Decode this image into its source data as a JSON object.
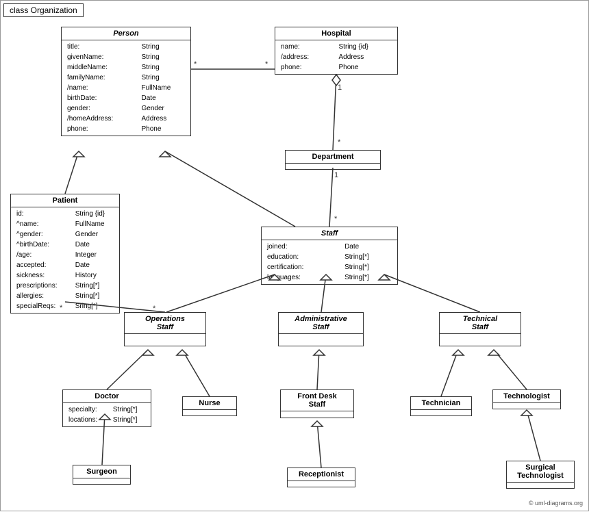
{
  "title": "class Organization",
  "classes": {
    "person": {
      "name": "Person",
      "italic": true,
      "attrs": [
        [
          "title:",
          "String"
        ],
        [
          "givenName:",
          "String"
        ],
        [
          "middleName:",
          "String"
        ],
        [
          "familyName:",
          "String"
        ],
        [
          "/name:",
          "FullName"
        ],
        [
          "birthDate:",
          "Date"
        ],
        [
          "gender:",
          "Gender"
        ],
        [
          "/homeAddress:",
          "Address"
        ],
        [
          "phone:",
          "Phone"
        ]
      ]
    },
    "hospital": {
      "name": "Hospital",
      "italic": false,
      "attrs": [
        [
          "name:",
          "String {id}"
        ],
        [
          "/address:",
          "Address"
        ],
        [
          "phone:",
          "Phone"
        ]
      ]
    },
    "department": {
      "name": "Department",
      "italic": false,
      "attrs": []
    },
    "staff": {
      "name": "Staff",
      "italic": true,
      "attrs": [
        [
          "joined:",
          "Date"
        ],
        [
          "education:",
          "String[*]"
        ],
        [
          "certification:",
          "String[*]"
        ],
        [
          "languages:",
          "String[*]"
        ]
      ]
    },
    "patient": {
      "name": "Patient",
      "italic": false,
      "attrs": [
        [
          "id:",
          "String {id}"
        ],
        [
          "^name:",
          "FullName"
        ],
        [
          "^gender:",
          "Gender"
        ],
        [
          "^birthDate:",
          "Date"
        ],
        [
          "/age:",
          "Integer"
        ],
        [
          "accepted:",
          "Date"
        ],
        [
          "sickness:",
          "History"
        ],
        [
          "prescriptions:",
          "String[*]"
        ],
        [
          "allergies:",
          "String[*]"
        ],
        [
          "specialReqs:",
          "Sring[*]"
        ]
      ]
    },
    "operations_staff": {
      "name": "Operations Staff",
      "italic": true,
      "attrs": []
    },
    "administrative_staff": {
      "name": "Administrative Staff",
      "italic": true,
      "attrs": []
    },
    "technical_staff": {
      "name": "Technical Staff",
      "italic": true,
      "attrs": []
    },
    "doctor": {
      "name": "Doctor",
      "italic": false,
      "attrs": [
        [
          "specialty:",
          "String[*]"
        ],
        [
          "locations:",
          "String[*]"
        ]
      ]
    },
    "nurse": {
      "name": "Nurse",
      "italic": false,
      "attrs": []
    },
    "front_desk_staff": {
      "name": "Front Desk Staff",
      "italic": false,
      "attrs": []
    },
    "technician": {
      "name": "Technician",
      "italic": false,
      "attrs": []
    },
    "technologist": {
      "name": "Technologist",
      "italic": false,
      "attrs": []
    },
    "surgeon": {
      "name": "Surgeon",
      "italic": false,
      "attrs": []
    },
    "receptionist": {
      "name": "Receptionist",
      "italic": false,
      "attrs": []
    },
    "surgical_technologist": {
      "name": "Surgical Technologist",
      "italic": false,
      "attrs": []
    }
  },
  "copyright": "© uml-diagrams.org"
}
